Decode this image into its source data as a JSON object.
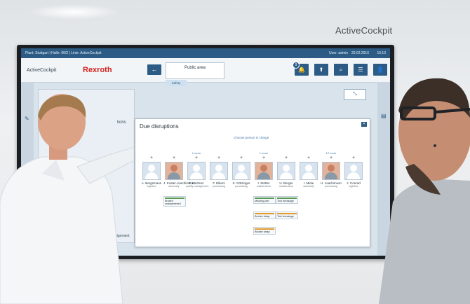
{
  "header": {
    "brand_label": "ActiveCockpit",
    "breadcrumb": "Plant: Stuttgart | Halle: 60/2 | Linie: ActiveCockpit",
    "user": "User: admin",
    "date": "29.02.2016",
    "time": "16:13"
  },
  "app": {
    "title": "ActiveCockpit",
    "logo": "Rexroth",
    "back_icon": "arrow-left-icon",
    "area_name": "Public area",
    "area_tab": "Safety",
    "notification_count": "9",
    "tools": [
      {
        "name": "bell-icon",
        "glyph": "🔔"
      },
      {
        "name": "upload-icon",
        "glyph": "⬆"
      },
      {
        "name": "search-icon",
        "glyph": "⌕"
      },
      {
        "name": "menu-icon",
        "glyph": "☰"
      },
      {
        "name": "user-icon",
        "glyph": "👤"
      }
    ]
  },
  "background_panel": {
    "side_label": "tions",
    "footer_label": "assignment"
  },
  "dialog": {
    "title": "Due disruptions",
    "hint": "Choose person in charge",
    "people": [
      {
        "more": "",
        "name": "A. Bergsmann",
        "role": "logistics",
        "photo": false
      },
      {
        "more": "",
        "name": "J. Koster-Joachimson",
        "role": "assembly",
        "photo": true
      },
      {
        "more": "1 more",
        "name": "F. Metzner",
        "role": "quality management",
        "photo": false
      },
      {
        "more": "",
        "name": "F. Elkers",
        "role": "purchasing",
        "photo": false
      },
      {
        "more": "",
        "name": "S. Götzinger",
        "role": "purchasing",
        "photo": false
      },
      {
        "more": "1 more",
        "name": "I. Stetter",
        "role": "maintenance",
        "photo": true
      },
      {
        "more": "",
        "name": "U. Berger",
        "role": "maintenance",
        "photo": false
      },
      {
        "more": "",
        "name": "I. Miele",
        "role": "assembly",
        "photo": false
      },
      {
        "more": "12 more",
        "name": "H. Joachimson",
        "role": "purchasing",
        "photo": true
      },
      {
        "more": "",
        "name": "J. Conrad",
        "role": "logistics",
        "photo": false
      }
    ],
    "cards": [
      {
        "label": "Broken unassembled",
        "col": 1,
        "row": 0,
        "color": "green"
      },
      {
        "label": "Missing part",
        "col": 5,
        "row": 0,
        "color": "green"
      },
      {
        "label": "Broken strap",
        "col": 5,
        "row": 1,
        "color": "orange"
      },
      {
        "label": "Broken strap",
        "col": 5,
        "row": 2,
        "color": "orange"
      },
      {
        "label": "Tool breakage",
        "col": 6,
        "row": 0,
        "color": "green"
      },
      {
        "label": "Tool breakage",
        "col": 6,
        "row": 1,
        "color": "orange"
      }
    ]
  }
}
